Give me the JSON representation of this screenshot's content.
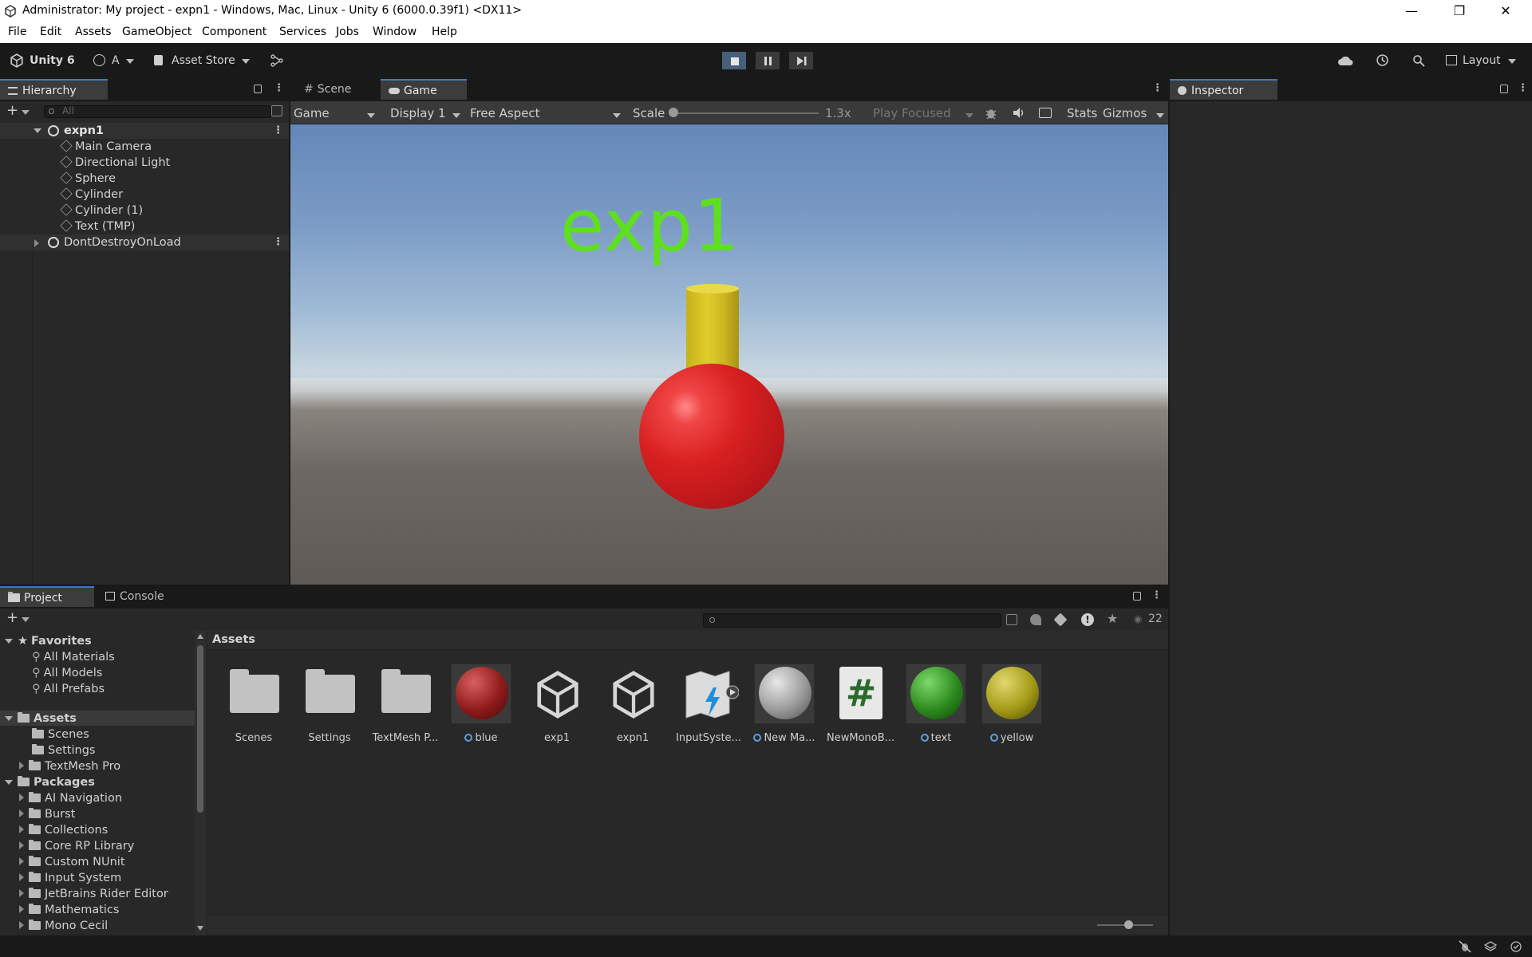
{
  "window": {
    "title": "Administrator: My project - expn1 - Windows, Mac, Linux - Unity 6 (6000.0.39f1) <DX11>",
    "minimize": "—",
    "maximize": "❐",
    "close": "✕"
  },
  "menu": [
    "File",
    "Edit",
    "Assets",
    "GameObject",
    "Component",
    "Services",
    "Jobs",
    "Window",
    "Help"
  ],
  "toolbar": {
    "product": "Unity 6",
    "account": "A",
    "asset_store": "Asset Store",
    "layout": "Layout"
  },
  "hierarchy": {
    "tab": "Hierarchy",
    "search_placeholder": "All",
    "scene": "expn1",
    "items": [
      "Main Camera",
      "Directional Light",
      "Sphere",
      "Cylinder",
      "Cylinder (1)",
      "Text (TMP)"
    ],
    "ddol": "DontDestroyOnLoad"
  },
  "center_tabs": {
    "scene": "Scene",
    "game": "Game"
  },
  "game_toolbar": {
    "view": "Game",
    "display": "Display 1",
    "aspect": "Free Aspect",
    "scale_label": "Scale",
    "scale_value": "1.3x",
    "play_mode": "Play Focused",
    "stats": "Stats",
    "gizmos": "Gizmos"
  },
  "game_view": {
    "text": "exp1",
    "text_color": "#5fe01f"
  },
  "inspector": {
    "tab": "Inspector"
  },
  "bottom_tabs": {
    "project": "Project",
    "console": "Console"
  },
  "project": {
    "count": "22",
    "breadcrumb": "Assets",
    "favorites_label": "Favorites",
    "favorites": [
      "All Materials",
      "All Models",
      "All Prefabs"
    ],
    "assets_label": "Assets",
    "assets_children": [
      "Scenes",
      "Settings",
      "TextMesh Pro"
    ],
    "packages_label": "Packages",
    "packages": [
      "AI Navigation",
      "Burst",
      "Collections",
      "Core RP Library",
      "Custom NUnit",
      "Input System",
      "JetBrains Rider Editor",
      "Mathematics",
      "Mono Cecil"
    ],
    "grid": [
      {
        "label": "Scenes",
        "kind": "folder"
      },
      {
        "label": "Settings",
        "kind": "folder"
      },
      {
        "label": "TextMesh P...",
        "kind": "folder"
      },
      {
        "label": "blue",
        "kind": "material",
        "color": "#8e1a1a"
      },
      {
        "label": "exp1",
        "kind": "scene"
      },
      {
        "label": "expn1",
        "kind": "scene"
      },
      {
        "label": "InputSyste...",
        "kind": "input"
      },
      {
        "label": "New Ma...",
        "kind": "material",
        "color": "#9a9a9a"
      },
      {
        "label": "NewMonoB...",
        "kind": "script"
      },
      {
        "label": "text",
        "kind": "material",
        "color": "#2c8a1e"
      },
      {
        "label": "yellow",
        "kind": "material",
        "color": "#a49a16"
      }
    ]
  }
}
